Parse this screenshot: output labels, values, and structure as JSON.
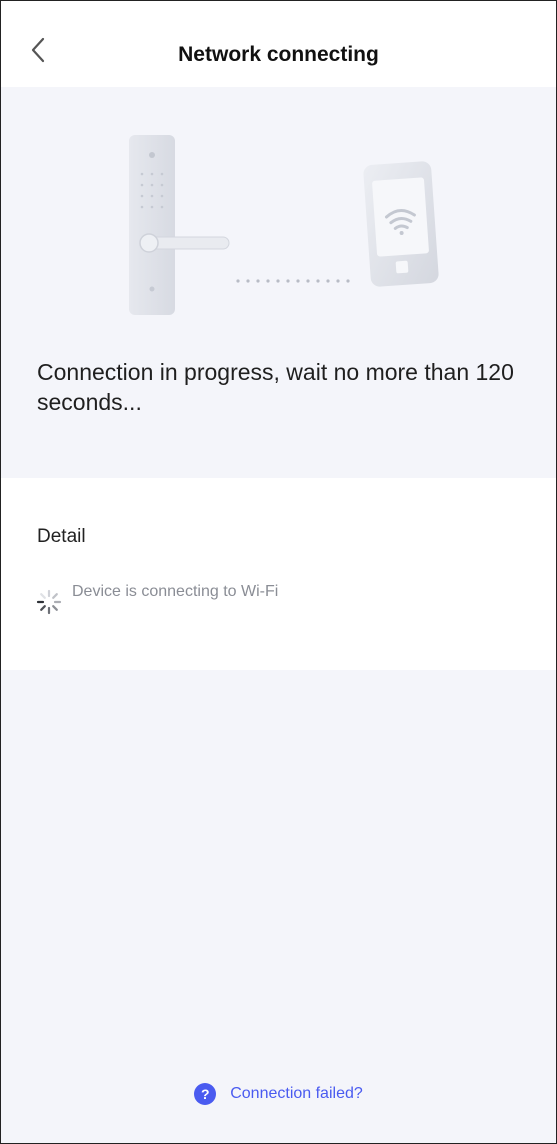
{
  "header": {
    "title": "Network connecting",
    "back_icon": "chevron-left-icon"
  },
  "illustration": {
    "lock_icon": "smart-lock-icon",
    "phone_icon": "phone-wifi-icon"
  },
  "status": {
    "message": "Connection in progress, wait no more than 120 seconds..."
  },
  "detail": {
    "title": "Detail",
    "steps": [
      {
        "label": "Device is connecting to Wi-Fi",
        "state": "in-progress"
      }
    ]
  },
  "help": {
    "icon_glyph": "?",
    "label": "Connection failed?"
  },
  "colors": {
    "accent": "#4a5bf0",
    "background": "#f4f5fa",
    "muted_text": "#8a8d95"
  }
}
